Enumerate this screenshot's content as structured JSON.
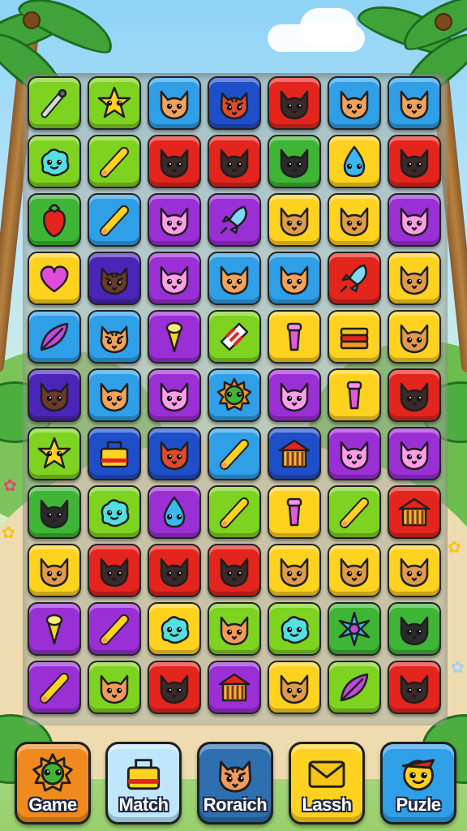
{
  "colors": {
    "lime": "#7ed321",
    "green": "#3fb535",
    "blue": "#2f9fe8",
    "navy": "#1f4fc8",
    "red": "#e3251e",
    "yellow": "#ffd21f",
    "purple": "#9b2fd6",
    "indigo": "#4b25b8"
  },
  "board": {
    "rows": [
      [
        [
          "lime",
          "wand"
        ],
        [
          "lime",
          "star"
        ],
        [
          "blue",
          "cat"
        ],
        [
          "navy",
          "tiger"
        ],
        [
          "red",
          "cat"
        ],
        [
          "blue",
          "cat"
        ],
        [
          "blue",
          "cat"
        ]
      ],
      [
        [
          "lime",
          "blob"
        ],
        [
          "lime",
          "pencil"
        ],
        [
          "red",
          "cat"
        ],
        [
          "red",
          "cat"
        ],
        [
          "green",
          "cat"
        ],
        [
          "yellow",
          "drop"
        ],
        [
          "red",
          "cat"
        ]
      ],
      [
        [
          "green",
          "berry"
        ],
        [
          "blue",
          "pencil"
        ],
        [
          "purple",
          "cat"
        ],
        [
          "purple",
          "rocket"
        ],
        [
          "yellow",
          "cat"
        ],
        [
          "yellow",
          "cat"
        ],
        [
          "purple",
          "cat"
        ]
      ],
      [
        [
          "yellow",
          "heart"
        ],
        [
          "indigo",
          "tiger"
        ],
        [
          "purple",
          "cat"
        ],
        [
          "blue",
          "cat"
        ],
        [
          "blue",
          "cat"
        ],
        [
          "red",
          "rocket"
        ],
        [
          "yellow",
          "cat"
        ]
      ],
      [
        [
          "blue",
          "leaf"
        ],
        [
          "blue",
          "tiger"
        ],
        [
          "purple",
          "cone"
        ],
        [
          "lime",
          "gift"
        ],
        [
          "yellow",
          "cup"
        ],
        [
          "yellow",
          "book"
        ],
        [
          "yellow",
          "cat"
        ]
      ],
      [
        [
          "indigo",
          "cat"
        ],
        [
          "blue",
          "cat"
        ],
        [
          "purple",
          "cat"
        ],
        [
          "blue",
          "sun"
        ],
        [
          "purple",
          "cat"
        ],
        [
          "yellow",
          "cup"
        ],
        [
          "red",
          "cat"
        ]
      ],
      [
        [
          "lime",
          "star"
        ],
        [
          "navy",
          "bag"
        ],
        [
          "navy",
          "cat"
        ],
        [
          "blue",
          "pencil"
        ],
        [
          "navy",
          "house"
        ],
        [
          "purple",
          "cat"
        ],
        [
          "purple",
          "cat"
        ]
      ],
      [
        [
          "green",
          "cat"
        ],
        [
          "lime",
          "blob"
        ],
        [
          "purple",
          "drop"
        ],
        [
          "lime",
          "pencil"
        ],
        [
          "yellow",
          "cup"
        ],
        [
          "lime",
          "pencil"
        ],
        [
          "red",
          "house"
        ]
      ],
      [
        [
          "yellow",
          "cat"
        ],
        [
          "red",
          "cat"
        ],
        [
          "red",
          "cat"
        ],
        [
          "red",
          "cat"
        ],
        [
          "yellow",
          "cat"
        ],
        [
          "yellow",
          "cat"
        ],
        [
          "yellow",
          "cat"
        ]
      ],
      [
        [
          "purple",
          "cone"
        ],
        [
          "purple",
          "pencil"
        ],
        [
          "yellow",
          "blob"
        ],
        [
          "lime",
          "cat"
        ],
        [
          "lime",
          "blob"
        ],
        [
          "green",
          "flower"
        ],
        [
          "green",
          "cat"
        ]
      ],
      [
        [
          "purple",
          "pencil"
        ],
        [
          "lime",
          "cat"
        ],
        [
          "red",
          "cat"
        ],
        [
          "purple",
          "house"
        ],
        [
          "yellow",
          "cat"
        ],
        [
          "lime",
          "leaf"
        ],
        [
          "red",
          "cat"
        ]
      ]
    ]
  },
  "buttons": [
    {
      "label": "Game",
      "color": "#f08a1e",
      "icon": "sun"
    },
    {
      "label": "Match",
      "color": "#bfe6fb",
      "icon": "bag"
    },
    {
      "label": "Roraich",
      "color": "#2f6fb0",
      "icon": "tiger"
    },
    {
      "label": "Lassh",
      "color": "#ffd21f",
      "icon": "envelope"
    },
    {
      "label": "Puzle",
      "color": "#2f9fe8",
      "icon": "face"
    }
  ]
}
